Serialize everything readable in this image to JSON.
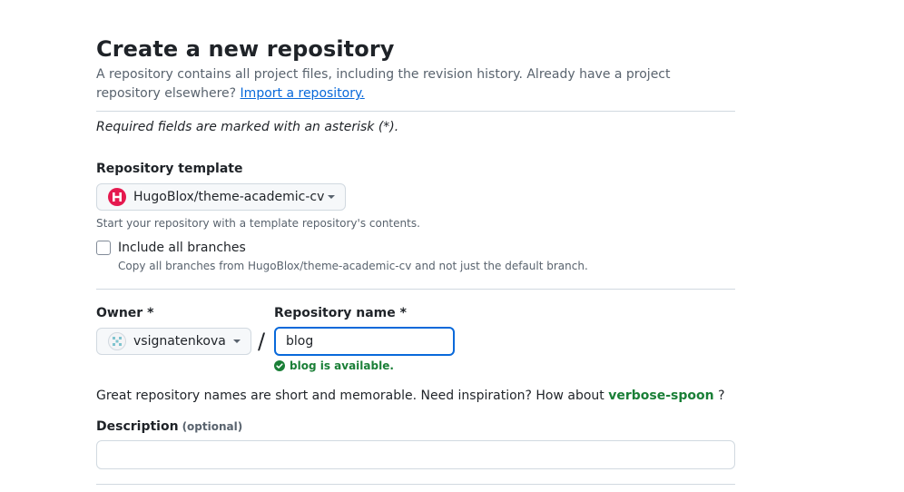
{
  "header": {
    "title": "Create a new repository",
    "subtitle": "A repository contains all project files, including the revision history. Already have a project repository elsewhere?",
    "import_link": "Import a repository."
  },
  "form": {
    "required_note": "Required fields are marked with an asterisk (*).",
    "template": {
      "label": "Repository template",
      "selected": "HugoBlox/theme-academic-cv",
      "hint": "Start your repository with a template repository's contents."
    },
    "include_branches": {
      "label": "Include all branches",
      "checked": false,
      "hint": "Copy all branches from HugoBlox/theme-academic-cv and not just the default branch."
    },
    "owner": {
      "label": "Owner *",
      "selected": "vsignatenkova"
    },
    "separator": "/",
    "repo_name": {
      "label": "Repository name *",
      "value": "blog",
      "availability": "blog is available."
    },
    "suggestion": {
      "text": "Great repository names are short and memorable. Need inspiration? How about",
      "name": "verbose-spoon",
      "suffix": "?"
    },
    "description": {
      "label": "Description",
      "optional": "(optional)",
      "value": ""
    }
  },
  "colors": {
    "link": "#0969da",
    "success": "#1a7f37",
    "template_avatar": "#e5194f",
    "focus": "#0969da"
  },
  "icons": {
    "template_avatar": "hugoblox-logo-icon",
    "owner_avatar": "identicon-avatar-icon",
    "caret": "caret-down-icon",
    "available": "check-circle-icon"
  }
}
